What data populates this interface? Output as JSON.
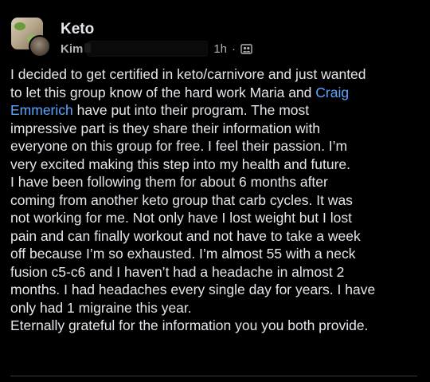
{
  "post": {
    "group_name": "Keto",
    "author_name": "Kim",
    "timestamp": "1h",
    "separator": "·",
    "audience_icon": "members-icon",
    "mention_color": "#5aa7ff",
    "lines": [
      {
        "text": "I decided to get certified in keto/carnivore and just wanted"
      },
      {
        "pre": "to let this group know of the hard work Maria and ",
        "mention": "Craig"
      },
      {
        "mention": "Emmerich",
        "post": " have put into their program. The most"
      },
      {
        "text": "impressive part is they share their information with"
      },
      {
        "text": "everyone on this group for free. I feel their passion.  I’m"
      },
      {
        "text": "very excited making this step into my health and future."
      },
      {
        "text": "I have been following them for about 6 months after"
      },
      {
        "text": "coming from another keto group that carb cycles.  It was"
      },
      {
        "text": "not working for me. Not only have I lost weight but I lost"
      },
      {
        "text": "pain and can finally workout and not have to take a week"
      },
      {
        "text": "off because I’m so exhausted.  I’m almost 55 with a neck"
      },
      {
        "text": "fusion c5-c6 and I haven’t had a headache in almost 2"
      },
      {
        "text": "months. I had headaches every single day for years.  I have"
      },
      {
        "text": "only had 1 migraine this year."
      },
      {
        "text": "Eternally grateful for the information you you both provide."
      }
    ]
  }
}
